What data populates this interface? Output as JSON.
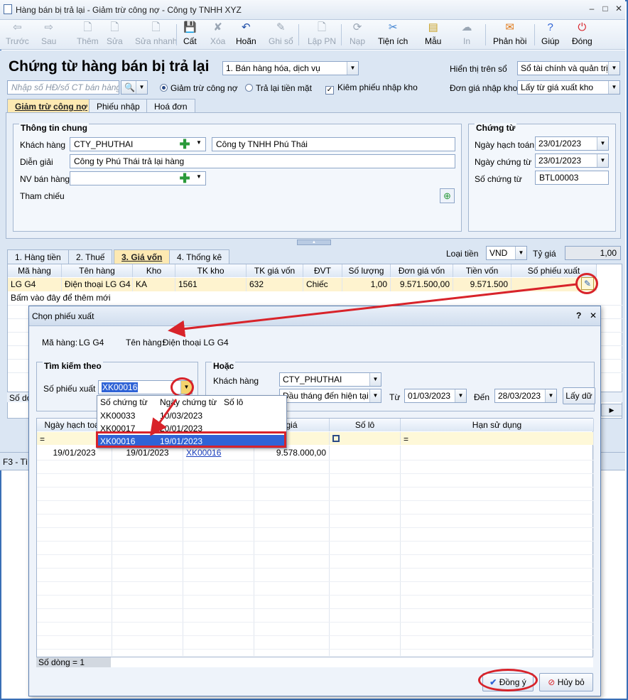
{
  "window": {
    "title": "Hàng bán bị trả lại - Giảm trừ công nợ - Công ty TNHH XYZ",
    "minimize": "–",
    "maximize": "□",
    "close": "✕"
  },
  "toolbar": {
    "items": [
      {
        "label": "Trước",
        "icon": "arrow-left-icon",
        "glyph": "⇦"
      },
      {
        "label": "Sau",
        "icon": "arrow-right-icon",
        "glyph": "⇨"
      },
      {
        "label": "Thêm",
        "icon": "new-doc-icon",
        "glyph": "🗋"
      },
      {
        "label": "Sửa",
        "icon": "edit-doc-icon",
        "glyph": "🗋"
      },
      {
        "label": "Sửa nhanh",
        "icon": "quick-edit-icon",
        "glyph": "🗋"
      },
      {
        "label": "Cất",
        "icon": "save-icon",
        "glyph": "💾"
      },
      {
        "label": "Xóa",
        "icon": "delete-icon",
        "glyph": "✘"
      },
      {
        "label": "Hoãn",
        "icon": "undo-icon",
        "glyph": "↶"
      },
      {
        "label": "Ghi sổ",
        "icon": "post-icon",
        "glyph": "✎"
      },
      {
        "label": "Lập PN",
        "icon": "create-receipt-icon",
        "glyph": "🗋"
      },
      {
        "label": "Nạp",
        "icon": "reload-icon",
        "glyph": "⟳"
      },
      {
        "label": "Tiện ích",
        "icon": "tools-icon",
        "glyph": "✂"
      },
      {
        "label": "Mẫu",
        "icon": "template-icon",
        "glyph": "▤"
      },
      {
        "label": "In",
        "icon": "print-icon",
        "glyph": "☁"
      },
      {
        "label": "Phản hồi",
        "icon": "mail-icon",
        "glyph": "✉"
      },
      {
        "label": "Giúp",
        "icon": "help-icon",
        "glyph": "?"
      },
      {
        "label": "Đóng",
        "icon": "close-power-icon",
        "glyph": "⏻"
      }
    ]
  },
  "header": {
    "title": "Chứng từ hàng bán bị trả lại",
    "type_select": "1. Bán hàng hóa, dịch vụ",
    "display_label": "Hiển thị trên sổ",
    "display_value": "Sổ tài chính và quản trị",
    "search_placeholder": "Nhập số HĐ/số CT bán hàng",
    "radio1": "Giảm trừ công nợ",
    "radio2": "Trả lại tiền mặt",
    "checkbox": "Kiêm phiếu nhập kho",
    "unit_price_label": "Đơn giá nhập kho",
    "unit_price_value": "Lấy từ giá xuất kho"
  },
  "tabs": [
    "Giảm trừ công nợ",
    "Phiếu nhập",
    "Hoá đơn"
  ],
  "general": {
    "title": "Thông tin chung",
    "customer_label": "Khách hàng",
    "customer_code": "CTY_PHUTHAI",
    "customer_name": "Công ty TNHH Phú Thái",
    "desc_label": "Diễn giải",
    "desc_value": "Công ty Phú Thái trả lại hàng",
    "sales_label": "NV bán hàng",
    "ref_label": "Tham chiếu"
  },
  "voucher": {
    "title": "Chứng từ",
    "posting_label": "Ngày hạch toán",
    "posting_value": "23/01/2023",
    "date_label": "Ngày chứng từ",
    "date_value": "23/01/2023",
    "no_label": "Số chứng từ",
    "no_value": "BTL00003"
  },
  "detail_tabs": [
    "1. Hàng tiền",
    "2. Thuế",
    "3. Giá vốn",
    "4. Thống kê"
  ],
  "currency": {
    "label": "Loại tiền",
    "value": "VND",
    "rate_label": "Tỷ giá",
    "rate_value": "1,00"
  },
  "grid": {
    "headers": [
      "Mã hàng",
      "Tên hàng",
      "Kho",
      "TK kho",
      "TK giá vốn",
      "ĐVT",
      "Số lượng",
      "Đơn giá vốn",
      "Tiền vốn",
      "Số phiếu xuất"
    ],
    "row": [
      "LG G4",
      "Điện thoại LG G4",
      "KA",
      "1561",
      "632",
      "Chiếc",
      "1,00",
      "9.571.500,00",
      "9.571.500",
      ""
    ],
    "add_row": "Bấm vào đây để thêm mới",
    "count_stub": "Số dò",
    "footer_stub": "F3 - Tì"
  },
  "dialog": {
    "title": "Chọn phiếu xuất",
    "help": "?",
    "close": "✕",
    "item_code_label": "Mã hàng:",
    "item_code": "LG G4",
    "item_name_label": "Tên hàng:",
    "item_name": "Điện thoại LG G4",
    "search_title": "Tìm kiếm theo",
    "voucher_label": "Số phiếu xuất",
    "voucher_value": "XK00016",
    "or_title": "Hoặc",
    "customer_label": "Khách hàng",
    "customer_value": "CTY_PHUTHAI",
    "period_value": "Đầu tháng đến hiện tại",
    "from_label": "Từ",
    "from_value": "01/03/2023",
    "to_label": "Đến",
    "to_value": "28/03/2023",
    "fetch_button": "Lấy dữ",
    "dropdown_headers": [
      "Số chứng từ",
      "Ngày chứng từ",
      "Số lô"
    ],
    "dropdown_rows": [
      [
        "XK00033",
        "10/03/2023"
      ],
      [
        "XK00017",
        "20/01/2023"
      ],
      [
        "XK00016",
        "19/01/2023"
      ]
    ],
    "grid_headers": [
      "Ngày hạch toán",
      "",
      "",
      "giá",
      "Số lô",
      "Hạn sử dụng"
    ],
    "grid_row": [
      "19/01/2023",
      "19/01/2023",
      "XK00016",
      "9.578.000,00"
    ],
    "row_count": "Số dòng = 1",
    "ok_button": "Đồng ý",
    "cancel_button": "Hủy bỏ"
  }
}
